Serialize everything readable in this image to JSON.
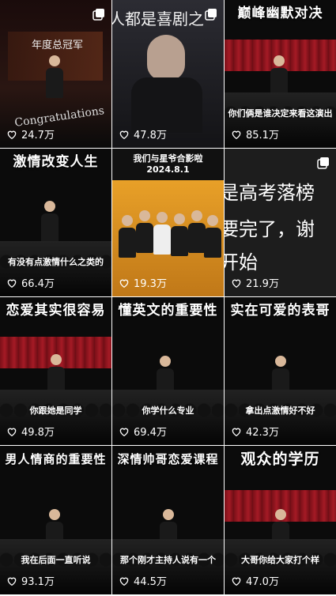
{
  "tiles": [
    {
      "title": "",
      "subtitle": "",
      "likes": "24.7万",
      "overlay": "Congratulations",
      "banner": "年度总冠军",
      "multi": true
    },
    {
      "title": "",
      "subtitle": "",
      "likes": "47.8万",
      "overlay": "人都是喜剧之",
      "multi": true
    },
    {
      "title": "巅峰幽默对决",
      "subtitle": "你们俩是谁决定来看这演出",
      "likes": "85.1万",
      "multi": false
    },
    {
      "title": "激情改变人生",
      "subtitle": "有没有点激情什么之类的",
      "likes": "66.4万",
      "multi": false
    },
    {
      "title": "",
      "subtitle": "",
      "likes": "19.3万",
      "banner": "我们与星爷合影啦",
      "date": "2024.8.1",
      "multi": false
    },
    {
      "title": "",
      "subtitle": "",
      "likes": "21.9万",
      "lines": [
        "是高考落榜",
        "要完了，谢",
        "开始"
      ],
      "multi": true
    },
    {
      "title": "恋爱其实很容易",
      "subtitle": "你跟她是同学",
      "likes": "49.8万",
      "multi": false
    },
    {
      "title": "懂英文的重要性",
      "subtitle": "你学什么专业",
      "likes": "69.4万",
      "multi": false
    },
    {
      "title": "实在可爱的表哥",
      "subtitle": "拿出点激情好不好",
      "likes": "42.3万",
      "multi": false
    },
    {
      "title": "男人情商的重要性",
      "subtitle": "我在后面一直听说",
      "likes": "93.1万",
      "multi": false
    },
    {
      "title": "深情帅哥恋爱课程",
      "subtitle": "那个刚才主持人说有一个",
      "likes": "44.5万",
      "multi": false
    },
    {
      "title": "观众的学历",
      "subtitle": "大哥你给大家打个样",
      "likes": "47.0万",
      "multi": false
    }
  ]
}
